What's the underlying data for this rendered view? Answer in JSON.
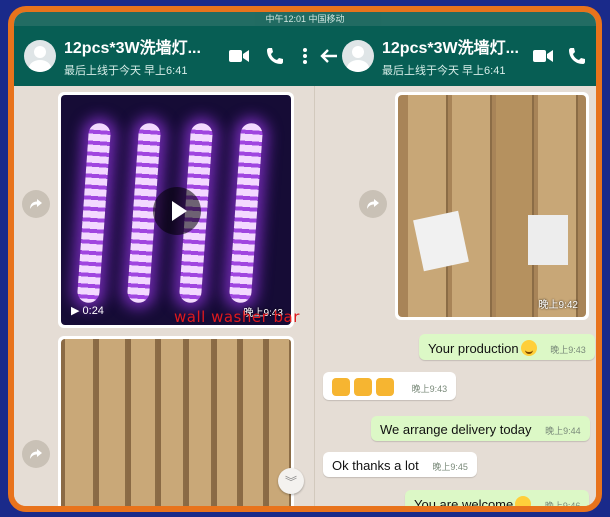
{
  "left_chat": {
    "title": "12pcs*3W洗墙灯...",
    "subtitle": "最后上线于今天 早上6:41",
    "video_duration": "0:24",
    "video_time": "晚上9:43",
    "watermark": "wall washer bar"
  },
  "right_chat": {
    "title": "12pcs*3W洗墙灯...",
    "subtitle": "最后上线于今天 早上6:41",
    "image_time": "晚上9:42",
    "messages": [
      {
        "text": "Your production",
        "time": "晚上9:43",
        "dir": "out"
      },
      {
        "text": "",
        "time": "晚上9:43",
        "dir": "in"
      },
      {
        "text": "We arrange delivery today",
        "time": "晚上9:44",
        "dir": "out"
      },
      {
        "text": "Ok thanks a lot",
        "time": "晚上9:45",
        "dir": "in"
      },
      {
        "text": "You are welcome",
        "time": "晚上9:46",
        "dir": "out"
      }
    ]
  },
  "statusbar": {
    "time": "中午12:01 中国移动"
  },
  "colors": {
    "header": "#075e54",
    "outgoing": "#dcf8c6",
    "frame": "#e8731c",
    "watermark": "#e0191d"
  },
  "icons": [
    "video-call-icon",
    "phone-icon",
    "more-icon",
    "back-arrow-icon",
    "forward-icon",
    "play-icon",
    "scroll-down-icon"
  ]
}
